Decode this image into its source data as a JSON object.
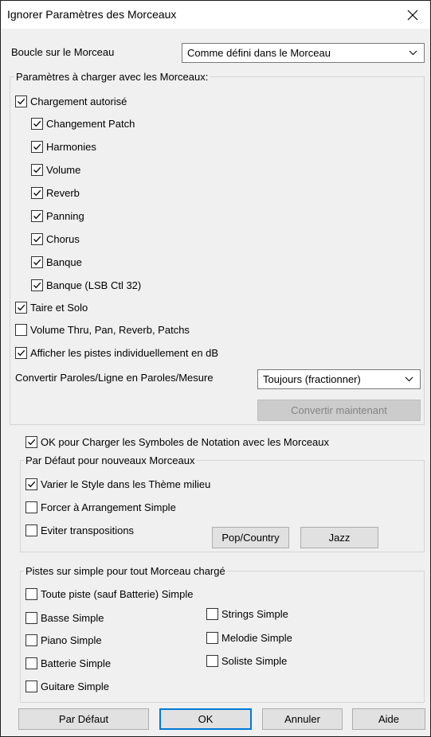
{
  "window": {
    "title": "Ignorer Paramètres des Morceaux",
    "close_icon": "close-icon"
  },
  "loop": {
    "label": "Boucle sur le Morceau",
    "value": "Comme défini dans le Morceau"
  },
  "load_settings": {
    "legend": "Paramètres à charger avec les Morceaux:",
    "load_allowed": {
      "label": "Chargement autorisé",
      "checked": true
    },
    "sub_items": [
      {
        "label": "Changement Patch",
        "checked": true
      },
      {
        "label": "Harmonies",
        "checked": true
      },
      {
        "label": "Volume",
        "checked": true
      },
      {
        "label": "Reverb",
        "checked": true
      },
      {
        "label": "Panning",
        "checked": true
      },
      {
        "label": "Chorus",
        "checked": true
      },
      {
        "label": "Banque",
        "checked": true
      },
      {
        "label": "Banque (LSB Ctl 32)",
        "checked": true
      }
    ],
    "mute_solo": {
      "label": "Taire et Solo",
      "checked": true
    },
    "volume_thru": {
      "label": "Volume Thru, Pan, Reverb, Patchs",
      "checked": false
    },
    "show_db": {
      "label": "Afficher les pistes individuellement en dB",
      "checked": true
    },
    "convert": {
      "label": "Convertir Paroles/Ligne en Paroles/Mesure",
      "value": "Toujours (fractionner)",
      "button": "Convertir maintenant"
    }
  },
  "notation": {
    "label": "OK pour Charger les Symboles de Notation avec les Morceaux",
    "checked": true
  },
  "defaults": {
    "legend": "Par Défaut pour nouveaux Morceaux",
    "vary_style": {
      "label": "Varier le Style dans les Thème milieu",
      "checked": true
    },
    "force_simple": {
      "label": "Forcer à Arrangement Simple",
      "checked": false
    },
    "avoid_transpose": {
      "label": "Eviter transpositions",
      "checked": false
    },
    "pop_button": "Pop/Country",
    "jazz_button": "Jazz"
  },
  "simple_tracks": {
    "legend": "Pistes sur simple pour tout Morceau chargé",
    "all_tracks": {
      "label": "Toute piste (sauf Batterie) Simple",
      "checked": false
    },
    "left": [
      {
        "label": "Basse Simple",
        "checked": false
      },
      {
        "label": "Piano Simple",
        "checked": false
      },
      {
        "label": "Batterie Simple",
        "checked": false
      },
      {
        "label": "Guitare Simple",
        "checked": false
      }
    ],
    "right": [
      {
        "label": "Strings Simple",
        "checked": false
      },
      {
        "label": "Melodie Simple",
        "checked": false
      },
      {
        "label": "Soliste Simple",
        "checked": false
      }
    ]
  },
  "footer": {
    "default_button": "Par Défaut",
    "ok_button": "OK",
    "cancel_button": "Annuler",
    "help_button": "Aide"
  },
  "colors": {
    "accent": "#0078d7",
    "window_bg": "#f0f0f0"
  }
}
